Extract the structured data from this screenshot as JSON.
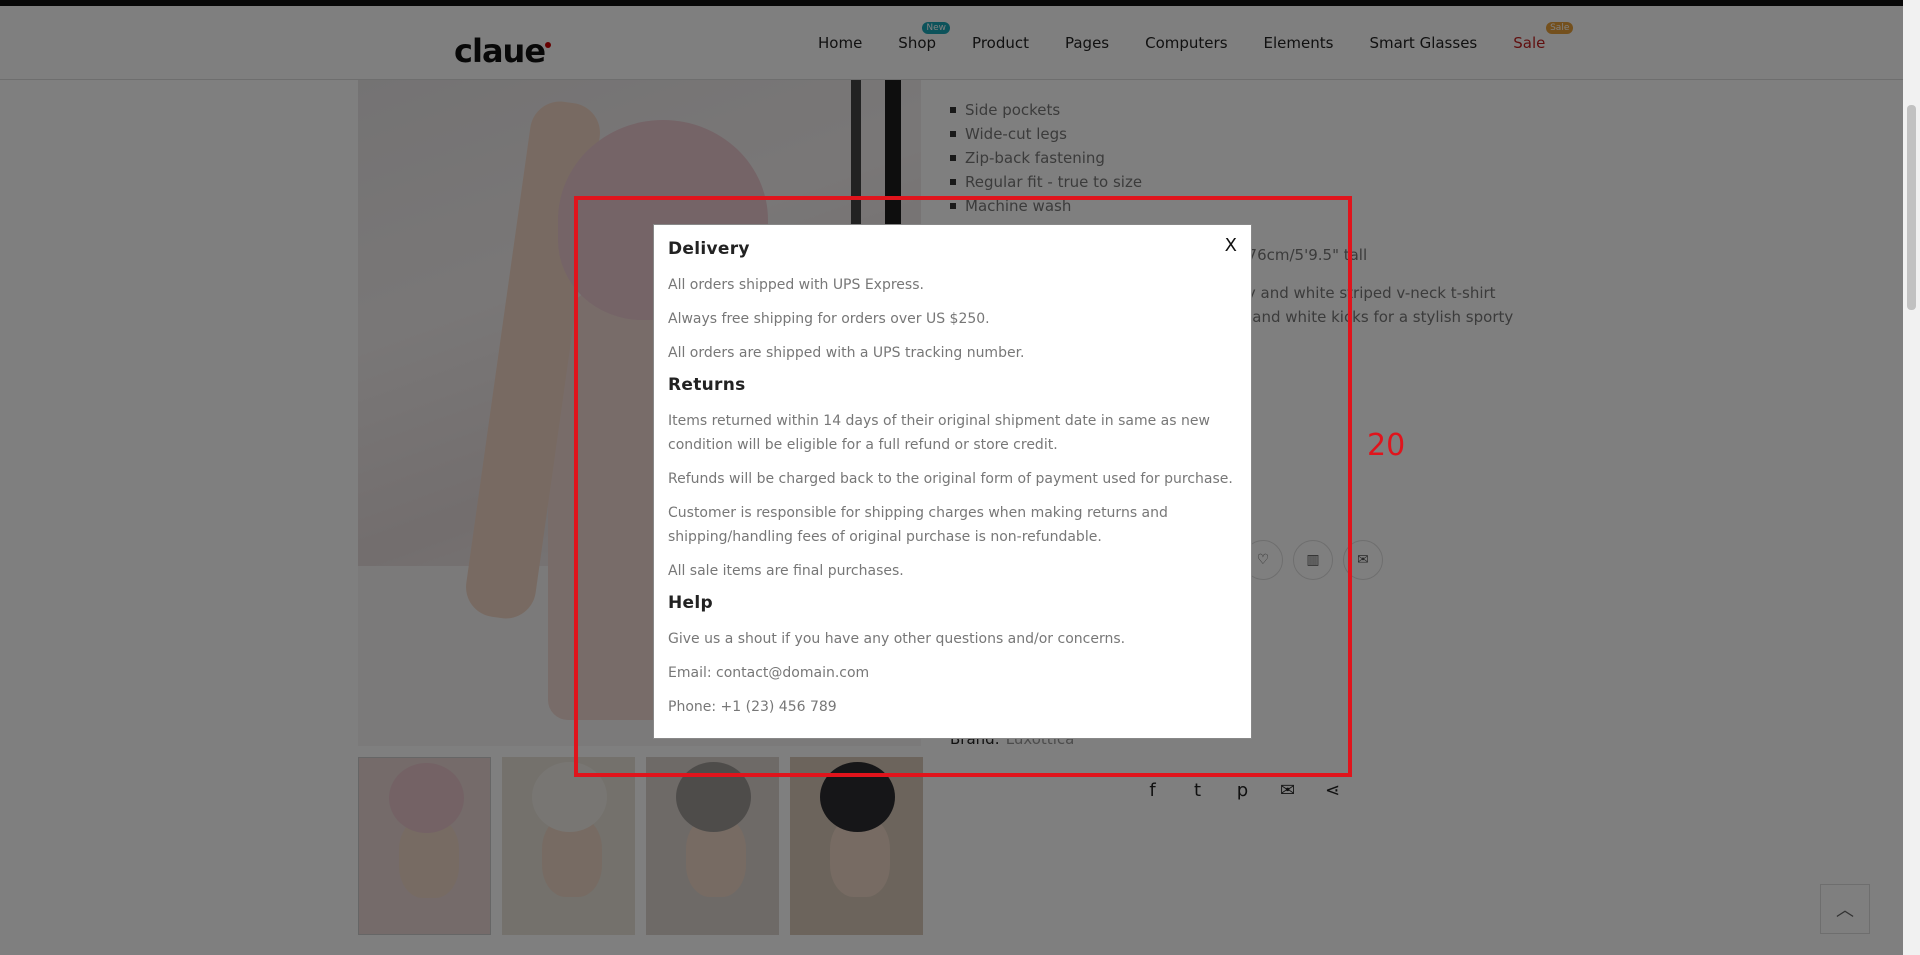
{
  "header": {
    "logo": "claue",
    "nav": [
      {
        "label": "Home",
        "badge": ""
      },
      {
        "label": "Shop",
        "badge": "New"
      },
      {
        "label": "Product",
        "badge": ""
      },
      {
        "label": "Pages",
        "badge": ""
      },
      {
        "label": "Computers",
        "badge": ""
      },
      {
        "label": "Elements",
        "badge": ""
      },
      {
        "label": "Smart Glasses",
        "badge": ""
      },
      {
        "label": "Sale",
        "badge": "Sale"
      }
    ]
  },
  "product": {
    "bullets": [
      "Side pockets",
      "Wide-cut legs",
      "Zip-back fastening",
      "Regular fit - true to size",
      "Machine wash"
    ],
    "model_fragment": "176cm/5'9.5\" tall",
    "desc_line1": "vy and white striped v-neck t-shirt",
    "desc_line2": "n and white kicks for a stylish sporty",
    "brand_label": "Brand:",
    "brand_value": "Luxottica"
  },
  "modal": {
    "close_label": "X",
    "delivery_title": "Delivery",
    "delivery": [
      "All orders shipped with UPS Express.",
      "Always free shipping for orders over US $250.",
      "All orders are shipped with a UPS tracking number."
    ],
    "returns_title": "Returns",
    "returns": [
      "Items returned within 14 days of their original shipment date in same as new condition will be eligible for a full refund or store credit.",
      "Refunds will be charged back to the original form of payment used for purchase.",
      "Customer is responsible for shipping charges when making returns and shipping/handling fees of original purchase is non-refundable.",
      "All sale items are final purchases."
    ],
    "help_title": "Help",
    "help": [
      "Give us a shout if you have any other questions and/or concerns.",
      "Email: contact@domain.com",
      "Phone: +1 (23) 456 789"
    ]
  },
  "annotation": {
    "number": "20",
    "color": "#e0141c"
  }
}
